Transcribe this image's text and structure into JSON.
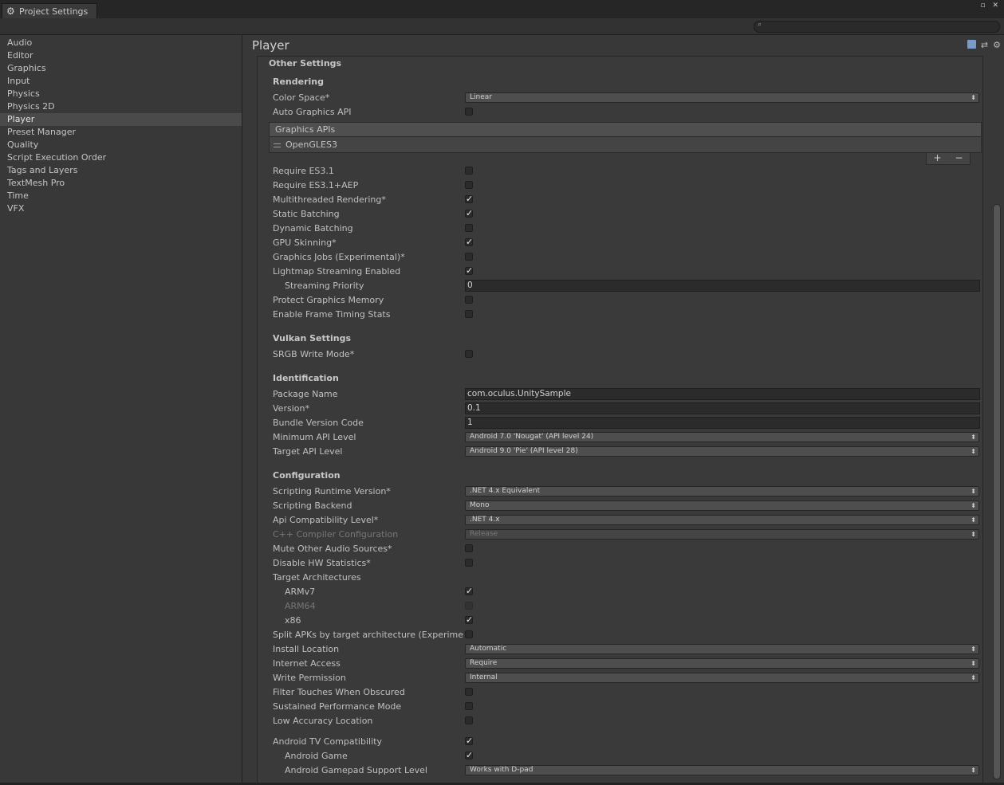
{
  "window": {
    "tab_title": "Project Settings",
    "controls": "▫ ✕"
  },
  "search": {
    "placeholder": ""
  },
  "sidebar": {
    "items": [
      "Audio",
      "Editor",
      "Graphics",
      "Input",
      "Physics",
      "Physics 2D",
      "Player",
      "Preset Manager",
      "Quality",
      "Script Execution Order",
      "Tags and Layers",
      "TextMesh Pro",
      "Time",
      "VFX"
    ],
    "selected": "Player"
  },
  "main": {
    "title": "Player",
    "section": "Other Settings",
    "rendering": {
      "header": "Rendering",
      "color_space": {
        "label": "Color Space*",
        "value": "Linear"
      },
      "auto_graphics_api": {
        "label": "Auto Graphics API",
        "checked": false
      },
      "graphics_apis": {
        "header": "Graphics APIs",
        "entries": [
          "OpenGLES3"
        ],
        "add": "+",
        "remove": "−"
      },
      "require_es31": {
        "label": "Require ES3.1",
        "checked": false
      },
      "require_es31_aep": {
        "label": "Require ES3.1+AEP",
        "checked": false
      },
      "multithreaded": {
        "label": "Multithreaded Rendering*",
        "checked": true
      },
      "static_batching": {
        "label": "Static Batching",
        "checked": true
      },
      "dynamic_batching": {
        "label": "Dynamic Batching",
        "checked": false
      },
      "gpu_skinning": {
        "label": "GPU Skinning*",
        "checked": true
      },
      "graphics_jobs": {
        "label": "Graphics Jobs (Experimental)*",
        "checked": false
      },
      "lightmap_streaming": {
        "label": "Lightmap Streaming Enabled",
        "checked": true
      },
      "streaming_priority": {
        "label": "Streaming Priority",
        "value": "0"
      },
      "protect_memory": {
        "label": "Protect Graphics Memory",
        "checked": false
      },
      "frame_timing": {
        "label": "Enable Frame Timing Stats",
        "checked": false
      }
    },
    "vulkan": {
      "header": "Vulkan Settings",
      "srgb": {
        "label": "SRGB Write Mode*",
        "checked": false
      }
    },
    "identification": {
      "header": "Identification",
      "package_name": {
        "label": "Package Name",
        "value": "com.oculus.UnitySample"
      },
      "version": {
        "label": "Version*",
        "value": "0.1"
      },
      "bundle_code": {
        "label": "Bundle Version Code",
        "value": "1"
      },
      "min_api": {
        "label": "Minimum API Level",
        "value": "Android 7.0 'Nougat' (API level 24)"
      },
      "target_api": {
        "label": "Target API Level",
        "value": "Android 9.0 'Pie' (API level 28)"
      }
    },
    "configuration": {
      "header": "Configuration",
      "runtime": {
        "label": "Scripting Runtime Version*",
        "value": ".NET 4.x Equivalent"
      },
      "backend": {
        "label": "Scripting Backend",
        "value": "Mono"
      },
      "api_compat": {
        "label": "Api Compatibility Level*",
        "value": ".NET 4.x"
      },
      "cpp_config": {
        "label": "C++ Compiler Configuration",
        "value": "Release"
      },
      "mute_audio": {
        "label": "Mute Other Audio Sources*",
        "checked": false
      },
      "disable_hw": {
        "label": "Disable HW Statistics*",
        "checked": false
      },
      "target_arch": {
        "label": "Target Architectures"
      },
      "armv7": {
        "label": "ARMv7",
        "checked": true
      },
      "arm64": {
        "label": "ARM64",
        "checked": false
      },
      "x86": {
        "label": "x86",
        "checked": true
      },
      "split_apks": {
        "label": "Split APKs by target architecture (Experimental)",
        "checked": false
      },
      "install_location": {
        "label": "Install Location",
        "value": "Automatic"
      },
      "internet": {
        "label": "Internet Access",
        "value": "Require"
      },
      "write_permission": {
        "label": "Write Permission",
        "value": "Internal"
      },
      "filter_touches": {
        "label": "Filter Touches When Obscured",
        "checked": false
      },
      "sustained": {
        "label": "Sustained Performance Mode",
        "checked": false
      },
      "low_accuracy": {
        "label": "Low Accuracy Location",
        "checked": false
      },
      "android_tv": {
        "label": "Android TV Compatibility",
        "checked": true
      },
      "android_game": {
        "label": "Android Game",
        "checked": true
      },
      "gamepad": {
        "label": "Android Gamepad Support Level",
        "value": "Works with D-pad"
      }
    }
  }
}
